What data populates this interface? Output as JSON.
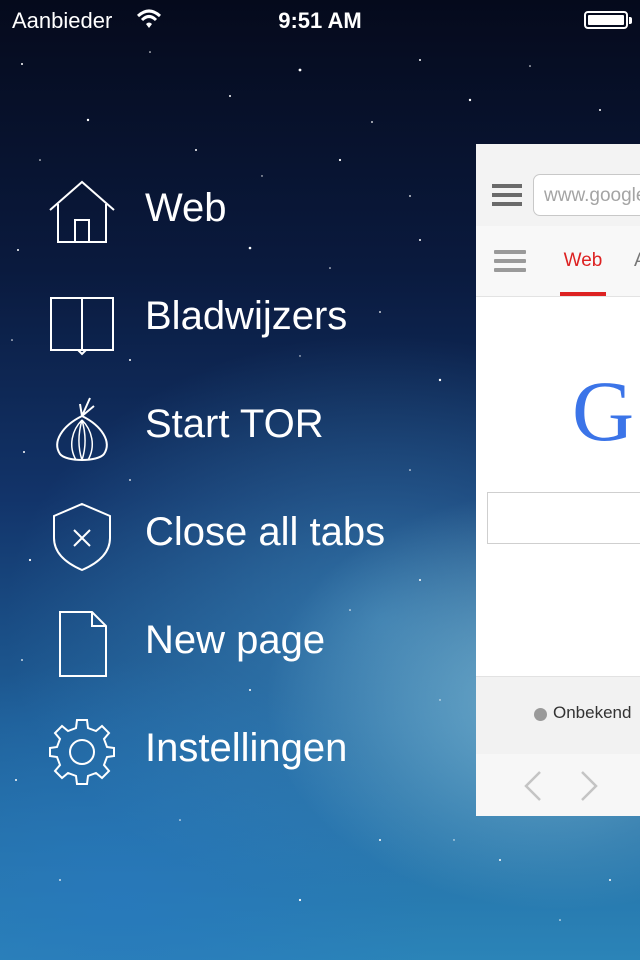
{
  "status_bar": {
    "carrier": "Aanbieder",
    "time": "9:51 AM",
    "wifi_icon": "wifi-icon",
    "battery_icon": "battery-icon"
  },
  "menu": {
    "items": [
      {
        "label": "Web",
        "icon": "home-icon"
      },
      {
        "label": "Bladwijzers",
        "icon": "book-icon"
      },
      {
        "label": "Start TOR",
        "icon": "onion-icon"
      },
      {
        "label": "Close all tabs",
        "icon": "shield-close-icon"
      },
      {
        "label": "New page",
        "icon": "document-icon"
      },
      {
        "label": "Instellingen",
        "icon": "gear-icon"
      }
    ]
  },
  "preview": {
    "url": "www.google",
    "tab_active": "Web",
    "tab_next": "A",
    "logo_letter": "G",
    "location": "Onbekend",
    "colors": {
      "accent_red": "#dd2222",
      "google_blue": "#3b74e8"
    }
  }
}
